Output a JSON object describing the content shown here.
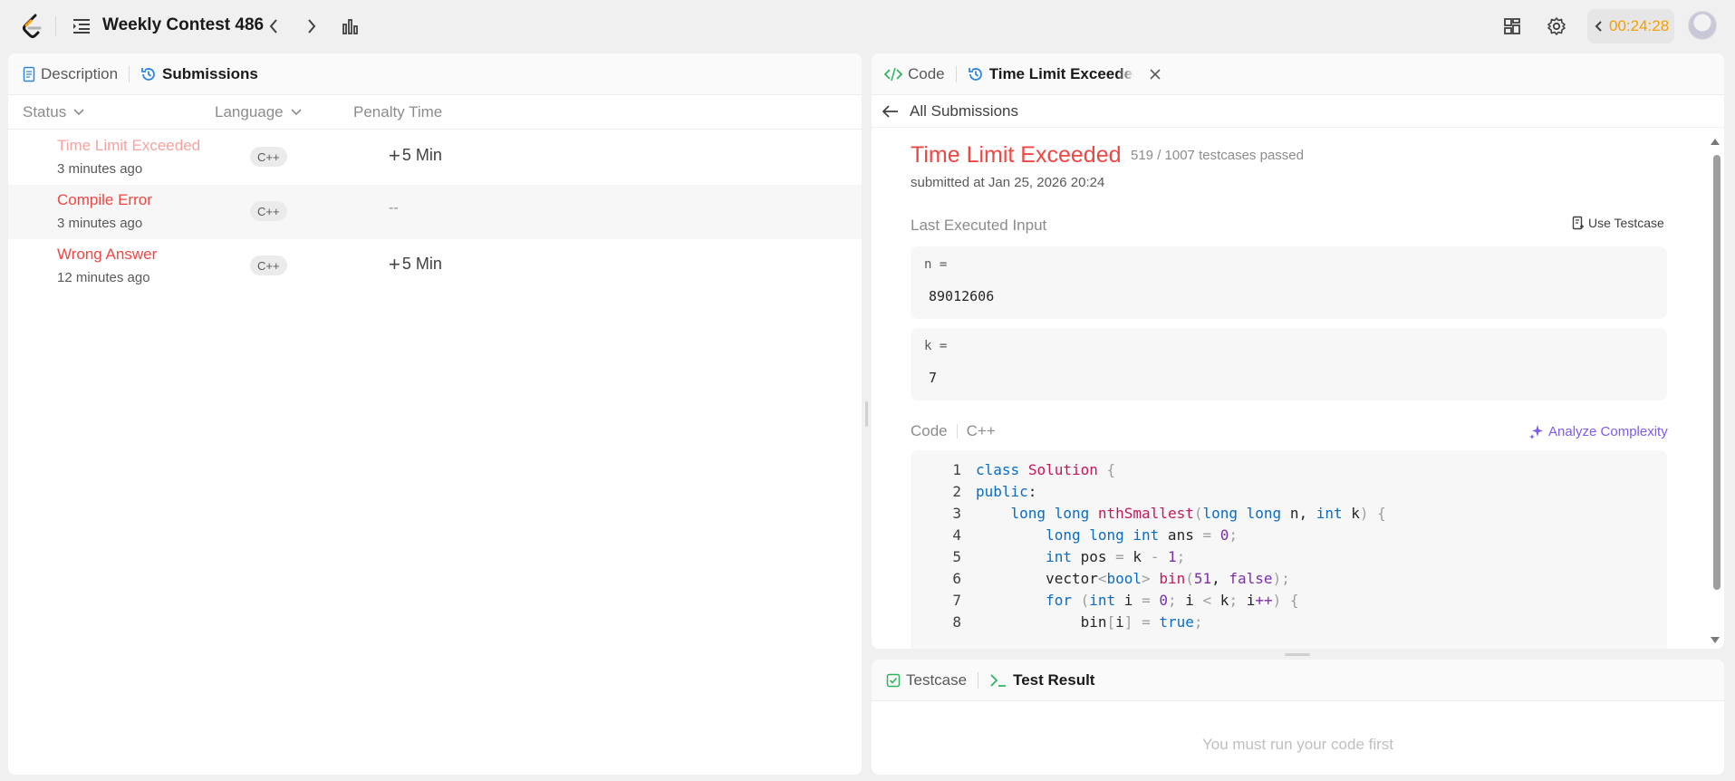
{
  "header": {
    "contest_title": "Weekly Contest 486",
    "timer": "00:24:28"
  },
  "left_panel": {
    "tabs": [
      {
        "label": "Description",
        "icon": "document-icon"
      },
      {
        "label": "Submissions",
        "icon": "history-icon"
      }
    ],
    "columns": {
      "status": "Status",
      "language": "Language",
      "penalty": "Penalty Time"
    },
    "rows": [
      {
        "status": "Time Limit Exceeded",
        "status_color": "#f5a3a1",
        "time_ago": "3 minutes ago",
        "language": "C++",
        "penalty": "5 Min",
        "penalty_prefix": "+"
      },
      {
        "status": "Compile Error",
        "status_color": "#ef4743",
        "time_ago": "3 minutes ago",
        "language": "C++",
        "penalty": "--",
        "penalty_prefix": ""
      },
      {
        "status": "Wrong Answer",
        "status_color": "#ef4743",
        "time_ago": "12 minutes ago",
        "language": "C++",
        "penalty": "5 Min",
        "penalty_prefix": "+"
      }
    ]
  },
  "right_panel": {
    "tabs": [
      {
        "label": "Code",
        "icon": "code-icon"
      },
      {
        "label": "Time Limit Exceedec",
        "icon": "history-icon"
      }
    ],
    "back_label": "All Submissions",
    "result": {
      "title": "Time Limit Exceeded",
      "passed": "519 / 1007 testcases passed",
      "submitted": "submitted at Jan 25, 2026 20:24"
    },
    "last_input_label": "Last Executed Input",
    "use_testcase_label": "Use Testcase",
    "inputs": [
      {
        "name": "n =",
        "value": "89012606"
      },
      {
        "name": "k =",
        "value": "7"
      }
    ],
    "code_label": "Code",
    "code_lang": "C++",
    "analyze_label": "Analyze Complexity",
    "code_lines": [
      "1",
      "2",
      "3",
      "4",
      "5",
      "6",
      "7",
      "8"
    ]
  },
  "bottom_panel": {
    "tabs": [
      {
        "label": "Testcase",
        "icon": "checkbox-icon"
      },
      {
        "label": "Test Result",
        "icon": "terminal-icon"
      }
    ],
    "empty_message": "You must run your code first"
  },
  "colors": {
    "error": "#ef4743",
    "timer": "#f59f00",
    "accent_purple": "#7b5cf0"
  }
}
